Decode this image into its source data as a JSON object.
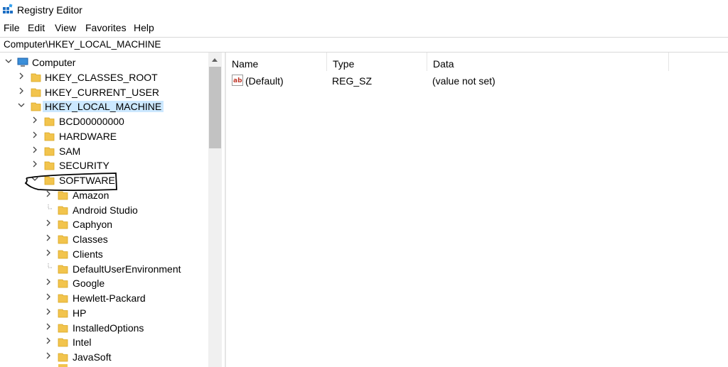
{
  "window": {
    "title": "Registry Editor"
  },
  "menu": [
    "File",
    "Edit",
    "View",
    "Favorites",
    "Help"
  ],
  "address": {
    "path": "Computer\\HKEY_LOCAL_MACHINE"
  },
  "tree": [
    {
      "label": "Computer",
      "expanded": true
    },
    {
      "label": "HKEY_CLASSES_ROOT"
    },
    {
      "label": "HKEY_CURRENT_USER"
    },
    {
      "label": "HKEY_LOCAL_MACHINE",
      "expanded": true,
      "selected": true
    },
    {
      "label": "BCD00000000"
    },
    {
      "label": "HARDWARE"
    },
    {
      "label": "SAM"
    },
    {
      "label": "SECURITY"
    },
    {
      "label": "SOFTWARE",
      "expanded": true
    },
    {
      "label": "Amazon"
    },
    {
      "label": "Android Studio"
    },
    {
      "label": "Caphyon"
    },
    {
      "label": "Classes"
    },
    {
      "label": "Clients"
    },
    {
      "label": "DefaultUserEnvironment"
    },
    {
      "label": "Google"
    },
    {
      "label": "Hewlett-Packard"
    },
    {
      "label": "HP"
    },
    {
      "label": "InstalledOptions"
    },
    {
      "label": "Intel"
    },
    {
      "label": "JavaSoft"
    }
  ],
  "columns": {
    "name": "Name",
    "type": "Type",
    "data": "Data"
  },
  "values": [
    {
      "name": "(Default)",
      "type": "REG_SZ",
      "data": "(value not set)"
    }
  ],
  "colors": {
    "selection": "#cce8ff",
    "folder": "#f2c44d",
    "annotation": "#000000"
  }
}
